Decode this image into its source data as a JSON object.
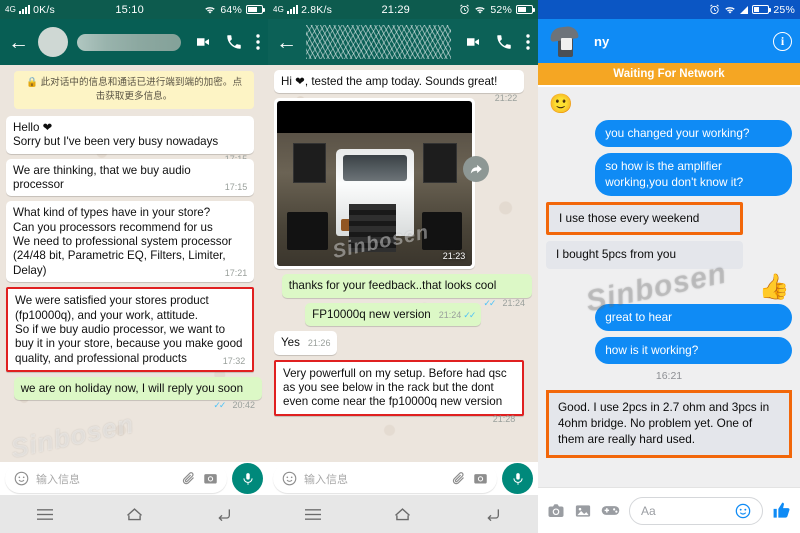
{
  "panels": [
    {
      "id": "whatsapp-left",
      "app": "WhatsApp",
      "statusbar": {
        "network": "4G",
        "speed": "0K/s",
        "time": "15:10",
        "battery": "64%",
        "wifi_icon": "wifi-icon",
        "signal_icon": "signal-bars-icon"
      },
      "header": {
        "back_icon": "back-arrow-icon",
        "contact_name_redacted": "",
        "video_icon": "video-call-icon",
        "call_icon": "phone-call-icon",
        "menu_icon": "overflow-menu-icon"
      },
      "encryption_notice": "🔒 此对话中的信息和通话已进行端到端的加密。点击获取更多信息。",
      "messages": [
        {
          "dir": "in",
          "text": "Hello ❤\nSorry but I've been very busy nowadays",
          "time": "17:15",
          "highlight": false
        },
        {
          "dir": "in",
          "text": "We are thinking, that we buy audio processor",
          "time": "17:15",
          "highlight": false
        },
        {
          "dir": "in",
          "text": "What kind of types have in your store?\nCan you processors recommend for us\nWe need to professional system processor (24/48 bit, Parametric EQ, Filters, Limiter, Delay)",
          "time": "17:21",
          "highlight": false
        },
        {
          "dir": "in",
          "text": "We were satisfied your stores product (fp10000q), and your work, attitude.\nSo if we buy audio processor, we want to buy it in your store, because you make good quality, and professional products",
          "time": "17:32",
          "highlight": true
        },
        {
          "dir": "out",
          "text": "we are on holiday now, I will reply you soon",
          "time": "20:42",
          "highlight": false,
          "ticks": "✓✓"
        }
      ],
      "input": {
        "emoji_icon": "emoji-icon",
        "placeholder": "输入信息",
        "attach_icon": "attachment-clip-icon",
        "camera_icon": "camera-icon",
        "mic_icon": "microphone-icon"
      },
      "navbar": {
        "menu_icon": "recents-menu-icon",
        "home_icon": "home-icon",
        "back_icon": "back-nav-icon"
      }
    },
    {
      "id": "whatsapp-right",
      "app": "WhatsApp",
      "statusbar": {
        "network": "4G",
        "speed": "2.8K/s",
        "time": "21:29",
        "battery": "52%",
        "alarm_icon": "alarm-clock-icon",
        "wifi_icon": "wifi-icon",
        "signal_icon": "signal-bars-icon"
      },
      "header": {
        "back_icon": "back-arrow-icon",
        "contact_name_redacted": "",
        "video_icon": "video-call-icon",
        "call_icon": "phone-call-icon",
        "menu_icon": "overflow-menu-icon"
      },
      "messages": [
        {
          "dir": "in",
          "type": "text",
          "text": "Hi ❤, tested the amp today. Sounds great!",
          "time": "21:22",
          "highlight": false
        },
        {
          "dir": "in",
          "type": "photo",
          "caption": "photo of white van in garage with PA speakers and amplifier rack",
          "time": "21:23",
          "highlight": false
        },
        {
          "dir": "out",
          "type": "text",
          "text": "thanks for your feedback..that looks cool",
          "time": "21:24",
          "highlight": false,
          "ticks": "✓✓"
        },
        {
          "dir": "out",
          "type": "text",
          "text": "FP10000q new version",
          "time": "21:24",
          "highlight": false,
          "ticks": "✓✓"
        },
        {
          "dir": "in",
          "type": "text",
          "text": "Yes",
          "time": "21:26",
          "highlight": false,
          "short": true
        },
        {
          "dir": "in",
          "type": "text",
          "text": "Very powerfull on my setup. Before had qsc as you see below in the rack but the dont even come near the fp10000q new version",
          "time": "21:28",
          "highlight": true
        }
      ],
      "forward_icon": "forward-arrow-icon",
      "input": {
        "emoji_icon": "emoji-icon",
        "placeholder": "输入信息",
        "attach_icon": "attachment-clip-icon",
        "camera_icon": "camera-icon",
        "mic_icon": "microphone-icon"
      },
      "navbar": {
        "menu_icon": "recents-menu-icon",
        "home_icon": "home-icon",
        "back_icon": "back-nav-icon"
      }
    },
    {
      "id": "messenger",
      "app": "Facebook Messenger",
      "statusbar": {
        "battery": "25%",
        "alarm_icon": "alarm-clock-icon",
        "wifi_icon": "wifi-icon",
        "signal_icon": "signal-triangle-icon"
      },
      "header": {
        "title": "ny",
        "info_icon": "info-circle-icon",
        "avatar_redacted": "redacted-avatar"
      },
      "banner": "Waiting For Network",
      "emoji_sticker": "🙂",
      "messages": [
        {
          "dir": "out",
          "text": "you changed your working?",
          "highlight": false
        },
        {
          "dir": "out",
          "text": "so how is the amplifier working,you don't know it?",
          "highlight": false
        },
        {
          "dir": "in",
          "text": "I use those every weekend",
          "highlight": true
        },
        {
          "dir": "in",
          "text": "I bought 5pcs from you",
          "highlight": false
        },
        {
          "dir": "out",
          "type": "sticker",
          "text": "👍",
          "highlight": false
        },
        {
          "dir": "out",
          "text": "great to hear",
          "highlight": false
        },
        {
          "dir": "out",
          "text": "how is it working?",
          "highlight": false
        }
      ],
      "timestamp": "16:21",
      "final_message": {
        "dir": "in",
        "text": "Good. I use 2pcs in 2.7 ohm and 3pcs in 4ohm bridge. No problem yet. One of them are really hard used.",
        "highlight": true
      },
      "input": {
        "camera_icon": "camera-icon",
        "gallery_icon": "gallery-image-icon",
        "games_icon": "game-controller-icon",
        "placeholder": "Aa",
        "emoji_icon": "emoji-smiley-icon",
        "like_icon": "thumbs-up-icon"
      }
    }
  ],
  "watermark": "Sinbosen",
  "colors": {
    "whatsapp_header": "#075e54",
    "whatsapp_out_bubble": "#dcf8c6",
    "whatsapp_chat_bg": "#ece5dd",
    "messenger_blue": "#0f8bf5",
    "messenger_banner": "#f5a623",
    "highlight_red": "#e02020",
    "highlight_orange": "#f2670a"
  }
}
